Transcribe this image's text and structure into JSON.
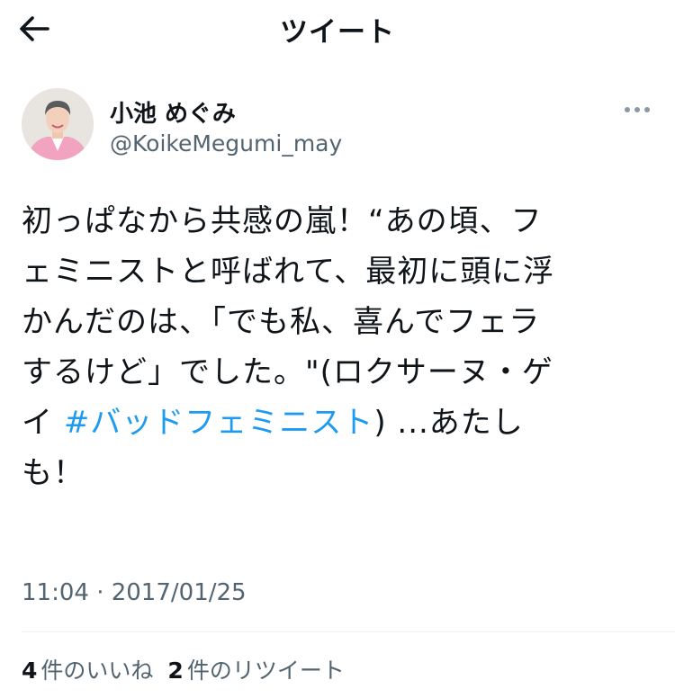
{
  "header": {
    "title": "ツイート",
    "back_icon": "arrow-left-icon"
  },
  "author": {
    "display_name": "小池 めぐみ",
    "handle": "@KoikeMegumi_may",
    "more_icon": "more-horizontal-icon"
  },
  "tweet": {
    "lines": [
      "初っぱなから共感の嵐！“あの頃、フ",
      "ェミニストと呼ばれて、最初に頭に浮",
      "かんだのは、「でも私、喜んでフェラ",
      "するけど」でした。\"(ロクサーヌ・ゲ"
    ],
    "line5_prefix": "イ ",
    "hashtag": "#バッドフェミニスト",
    "line5_suffix": ") ...あたし",
    "line6": "も！"
  },
  "timestamp": "11:04 · 2017/01/25",
  "stats": {
    "likes_count": "4",
    "likes_label": "件のいいね",
    "retweets_count": "2",
    "retweets_label": "件のリツイート"
  },
  "colors": {
    "text": "#0f1419",
    "secondary": "#536471",
    "link": "#1d9bf0",
    "divider": "#eff3f4"
  }
}
